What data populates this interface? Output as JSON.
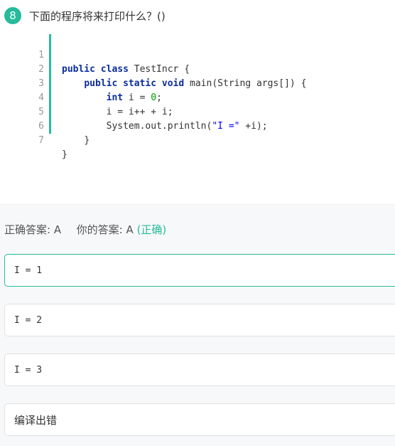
{
  "question": {
    "number": "8",
    "title": "下面的程序将来打印什么？()"
  },
  "code": {
    "line_numbers": [
      "1",
      "2",
      "3",
      "4",
      "5",
      "6",
      "7"
    ],
    "lines": [
      {
        "kw1": "public class",
        "rest": " TestIncr {"
      },
      {
        "indent": "    ",
        "kw1": "public static void",
        "rest": " main(String args[]) {"
      },
      {
        "indent": "        ",
        "kw1": "int",
        "rest": " i = ",
        "num": "0",
        "tail": ";"
      },
      {
        "indent": "        ",
        "plain": "i = i++ + i;"
      },
      {
        "indent": "        ",
        "plain": "System.out.println(",
        "str": "\"I =\"",
        "tail": " +i);"
      },
      {
        "indent": "    ",
        "plain": "}"
      },
      {
        "plain": "}"
      }
    ]
  },
  "result": {
    "correct_label": "正确答案:",
    "correct_value": "A",
    "your_label": "你的答案:",
    "your_value": "A",
    "status": "(正确)"
  },
  "options": [
    {
      "text": "I = 1",
      "selected": true
    },
    {
      "text": "I = 2",
      "selected": false
    },
    {
      "text": "I = 3",
      "selected": false
    },
    {
      "text": "编译出错",
      "selected": false
    }
  ],
  "colors": {
    "accent": "#25bb9b",
    "keyword": "#0b2d9c",
    "number": "#009900",
    "string": "#0000ff"
  }
}
